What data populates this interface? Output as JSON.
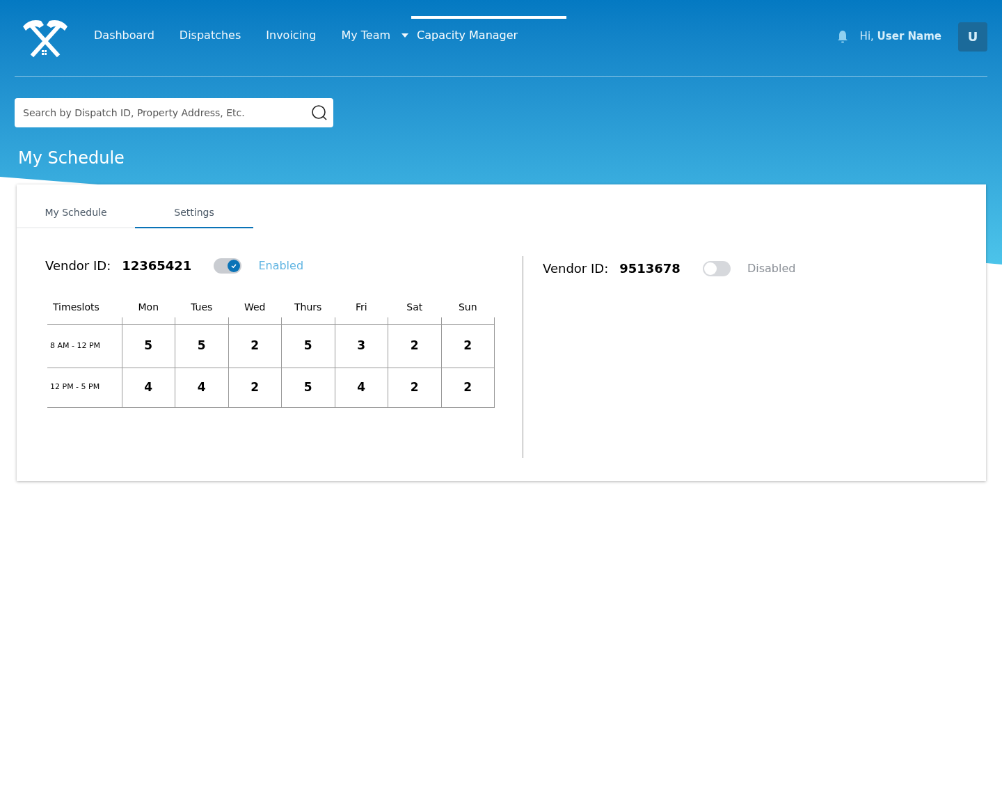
{
  "nav": {
    "items": [
      {
        "label": "Dashboard",
        "kind": "link",
        "selected": false
      },
      {
        "label": "Dispatches",
        "kind": "link",
        "selected": false
      },
      {
        "label": "Invoicing",
        "kind": "link",
        "selected": false
      },
      {
        "label": "My Team",
        "kind": "dropdown",
        "selected": false
      },
      {
        "label": "Capacity Manager",
        "kind": "link",
        "selected": true
      }
    ],
    "greeting": "Hi,",
    "user_name": "User Name",
    "avatar": "U"
  },
  "search": {
    "placeholder": "Search by Dispatch ID, Property Address, Etc."
  },
  "page_title": "My Schedule",
  "tabs": [
    {
      "label": "My Schedule",
      "selected": false
    },
    {
      "label": "Settings",
      "selected": true
    }
  ],
  "vendors": [
    {
      "label": "Vendor ID:",
      "id": "12365421",
      "enabled": true,
      "status": "Enabled",
      "schedule": {
        "columns": [
          "Timeslots",
          "Mon",
          "Tues",
          "Wed",
          "Thurs",
          "Fri",
          "Sat",
          "Sun"
        ],
        "rows": [
          {
            "slot": "8 AM - 12 PM",
            "values": [
              "5",
              "5",
              "2",
              "5",
              "3",
              "2",
              "2"
            ]
          },
          {
            "slot": "12 PM - 5 PM",
            "values": [
              "4",
              "4",
              "2",
              "5",
              "4",
              "2",
              "2"
            ]
          }
        ]
      }
    },
    {
      "label": "Vendor ID:",
      "id": "9513678",
      "enabled": false,
      "status": "Disabled"
    }
  ]
}
